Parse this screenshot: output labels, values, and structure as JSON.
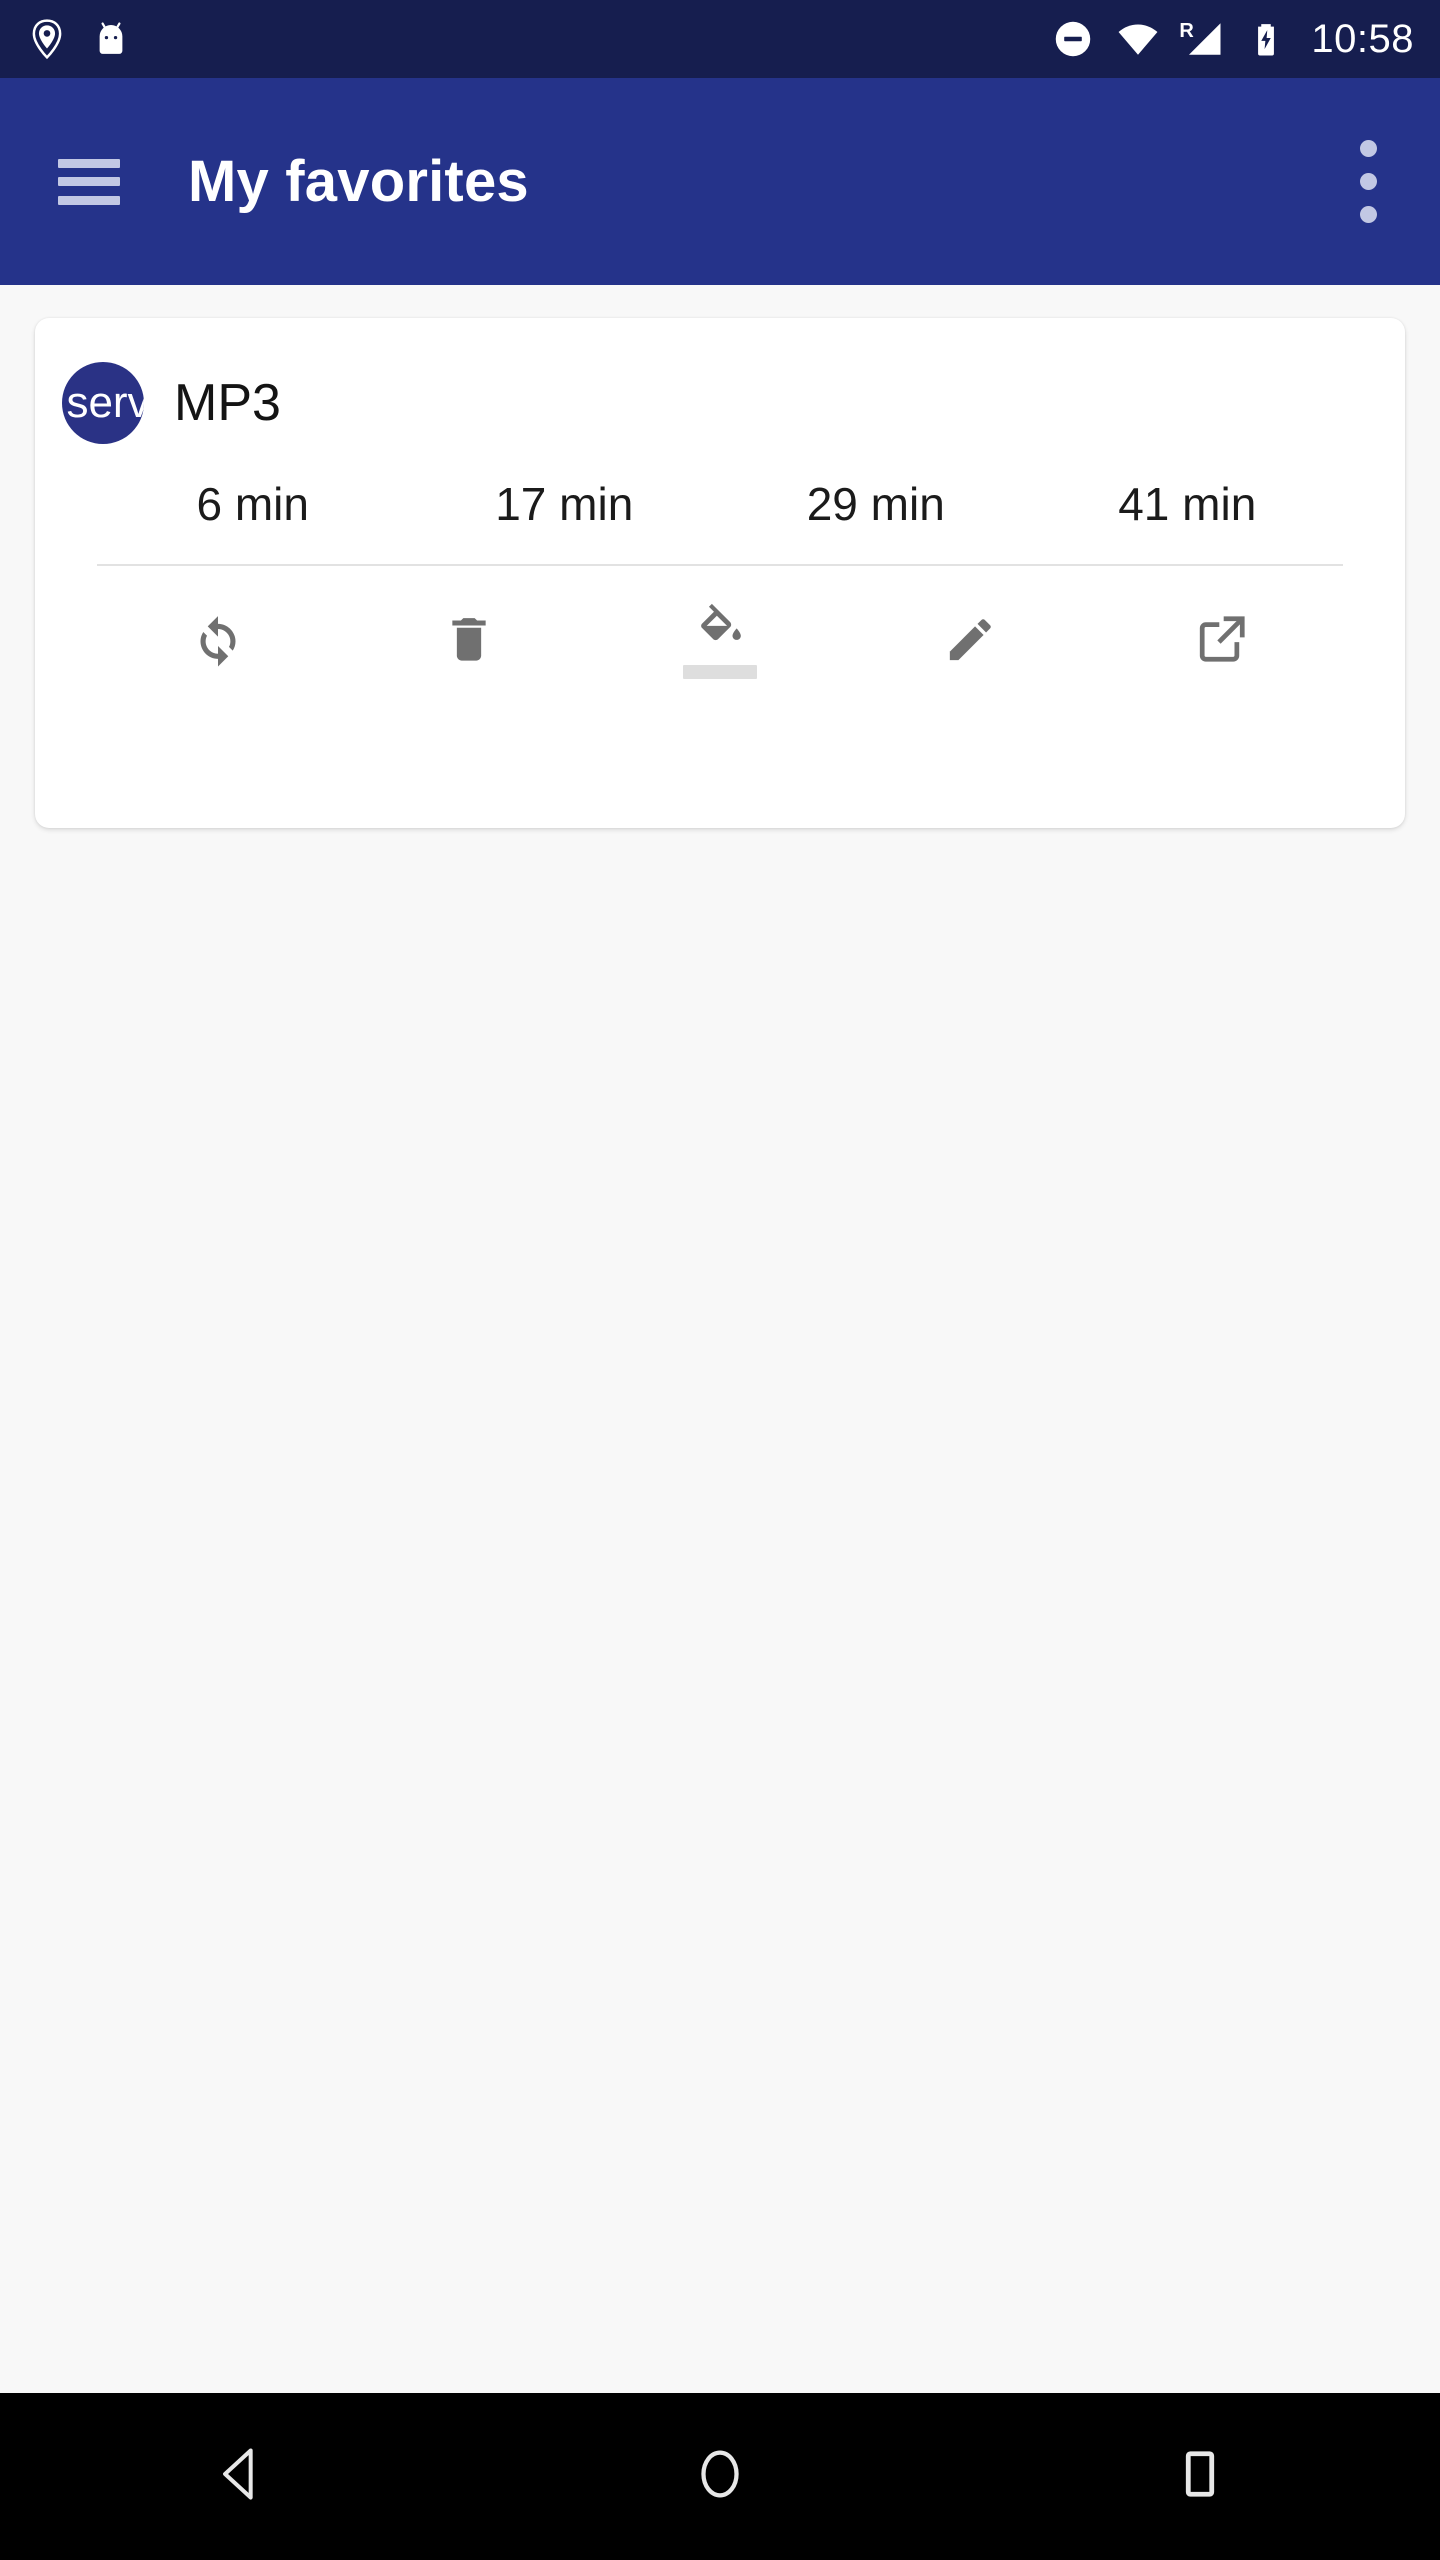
{
  "status_bar": {
    "background": "#161e4f",
    "time": "10:58",
    "left_icons": [
      {
        "name": "location-shield-icon",
        "label": "location shield"
      },
      {
        "name": "android-head-icon",
        "label": "android"
      }
    ],
    "right_icons": [
      {
        "name": "do-not-disturb-icon",
        "label": "do not disturb"
      },
      {
        "name": "wifi-icon",
        "label": "wifi"
      },
      {
        "name": "cellular-signal-icon",
        "label": "signal",
        "badge": "R"
      },
      {
        "name": "battery-charging-icon",
        "label": "battery charging"
      }
    ]
  },
  "app_bar": {
    "background": "#25338a",
    "icon_color": "#c2c8e4",
    "title": "My favorites",
    "menu_icon": "menu-icon",
    "overflow_icon": "more-vert-icon"
  },
  "card": {
    "avatar": {
      "text": "serv",
      "background": "#2a3285",
      "text_color": "#ffffff"
    },
    "title": "MP3",
    "times": [
      {
        "label": "6 min"
      },
      {
        "label": "17 min"
      },
      {
        "label": "29 min"
      },
      {
        "label": "41 min"
      }
    ],
    "actions": [
      {
        "name": "refresh-icon",
        "label": "Refresh"
      },
      {
        "name": "delete-icon",
        "label": "Delete"
      },
      {
        "name": "format-color-fill-icon",
        "label": "Fill color",
        "swatch": "#dedede"
      },
      {
        "name": "edit-icon",
        "label": "Edit"
      },
      {
        "name": "open-in-new-icon",
        "label": "Open"
      }
    ],
    "action_icon_color": "#707070"
  },
  "nav_bar": {
    "background": "#000000",
    "buttons": [
      {
        "name": "nav-back-button",
        "label": "Back"
      },
      {
        "name": "nav-home-button",
        "label": "Home"
      },
      {
        "name": "nav-recents-button",
        "label": "Recents"
      }
    ]
  }
}
